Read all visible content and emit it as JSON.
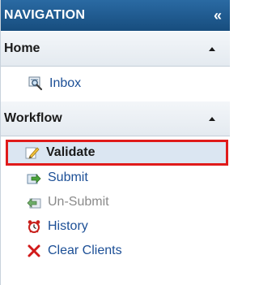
{
  "header": {
    "title": "NAVIGATION",
    "collapse_label": "«"
  },
  "sections": [
    {
      "label": "Home",
      "items": [
        {
          "label": "Inbox",
          "icon": "inbox-magnifier-icon"
        }
      ]
    },
    {
      "label": "Workflow",
      "items": [
        {
          "label": "Validate",
          "icon": "validate-pencil-icon",
          "state": "selected"
        },
        {
          "label": "Submit",
          "icon": "submit-arrow-icon"
        },
        {
          "label": "Un-Submit",
          "icon": "unsubmit-arrow-icon",
          "state": "disabled"
        },
        {
          "label": "History",
          "icon": "alarm-clock-icon"
        },
        {
          "label": "Clear Clients",
          "icon": "red-x-icon"
        }
      ]
    }
  ],
  "colors": {
    "header_bg": "#1f5a8f",
    "link": "#1c4f96",
    "selected_outline": "#e01b1b",
    "selected_bg": "#dbe6f2"
  }
}
